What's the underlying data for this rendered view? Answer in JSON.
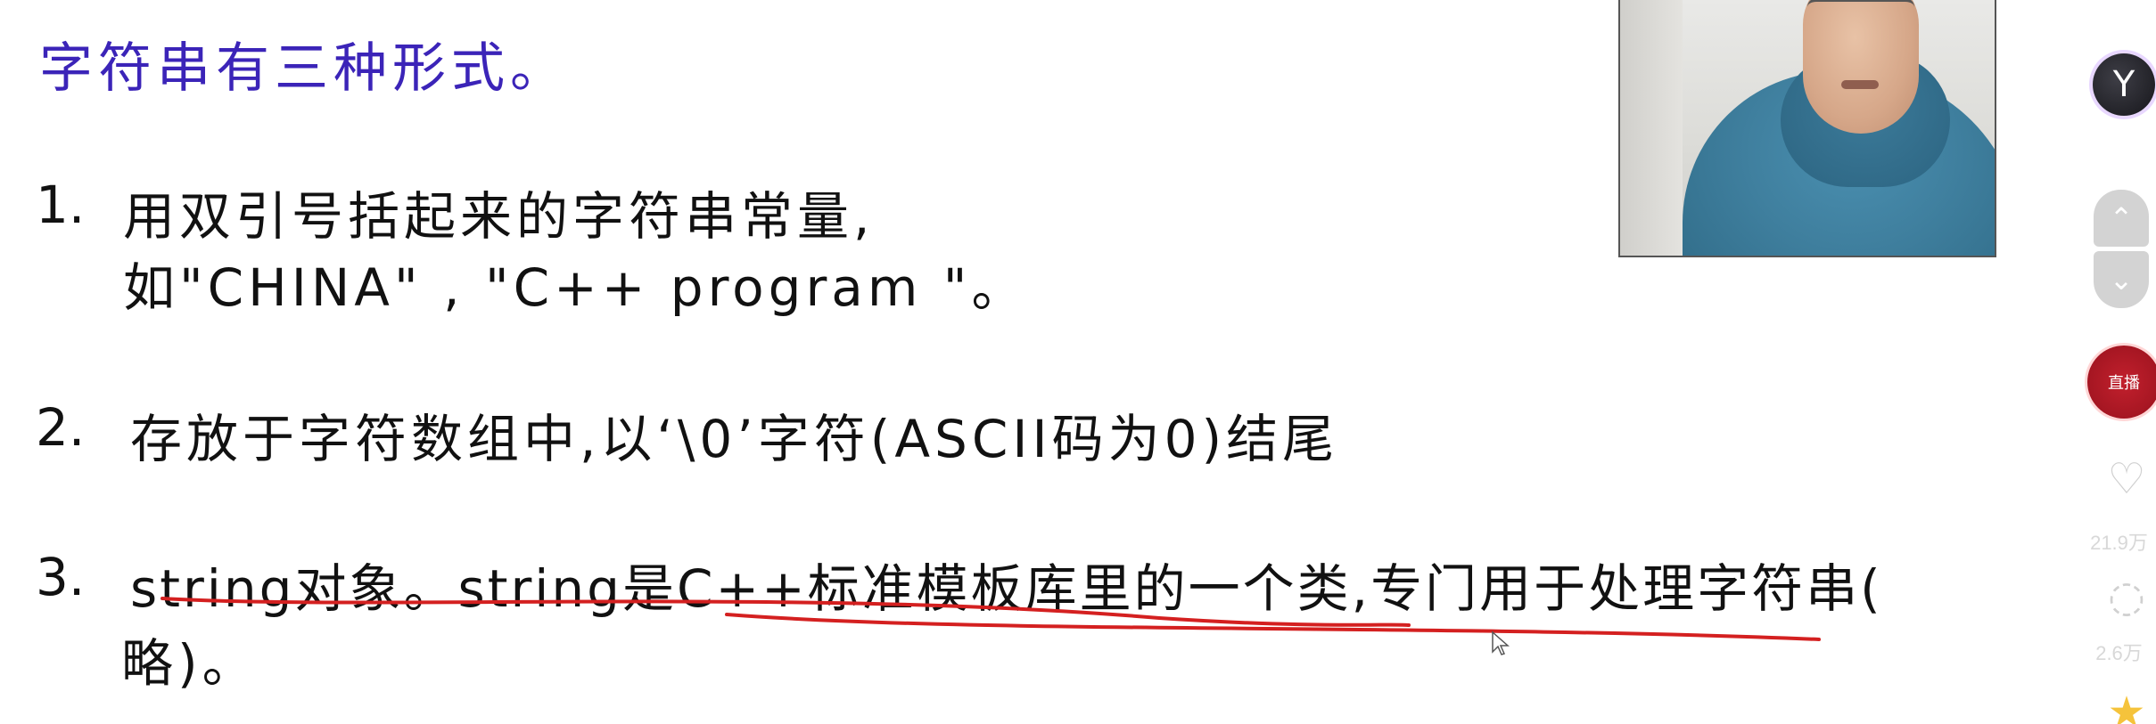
{
  "slide": {
    "title": "字符串有三种形式。",
    "items": [
      {
        "number": "1.",
        "line1": "用双引号括起来的字符串常量,",
        "line2": "如\"CHINA\" ,  \"C++ program \"。"
      },
      {
        "number": "2.",
        "line1": "存放于字符数组中,以‘\\0’字符(ASCII码为0)结尾"
      },
      {
        "number": "3.",
        "line1": "string对象。string是C++标准模板库里的一个类,专门用于处理字符串(",
        "line2": "略)。"
      }
    ]
  },
  "side_panel": {
    "logo_glyph": "Y",
    "live_badge_text": "直播",
    "like_count": "21.9万",
    "comment_count": "2.6万",
    "scroll_up_glyph": "⌃",
    "scroll_down_glyph": "⌄"
  },
  "colors": {
    "title": "#3b24b8",
    "annotation": "#d42020",
    "live_badge": "#b21a26"
  }
}
